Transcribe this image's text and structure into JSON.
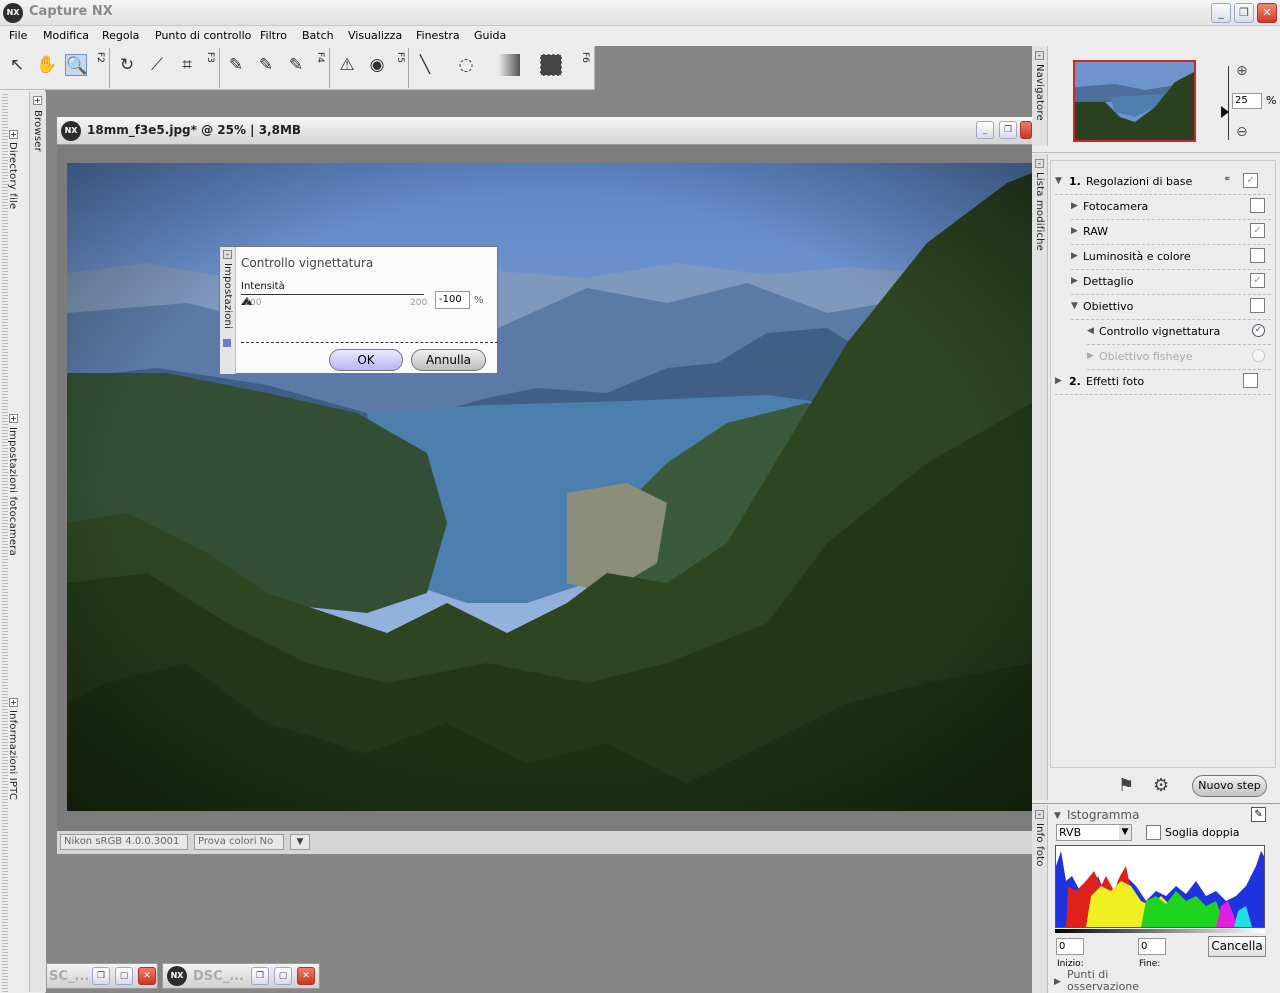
{
  "app": {
    "logo": "NX",
    "title": "Capture NX"
  },
  "window_controls": {
    "minimize": "_",
    "restore": "❐",
    "close": "✕"
  },
  "menu": [
    "File",
    "Modifica",
    "Regola",
    "Punto di controllo",
    "Filtro",
    "Batch",
    "Visualizza",
    "Finestra",
    "Guida"
  ],
  "toolbar": {
    "tools": [
      "arrow-icon",
      "hand-icon",
      "zoom-icon",
      "rotate-icon",
      "straighten-icon",
      "crop-icon",
      "black-point-icon",
      "neutral-point-icon",
      "white-point-icon",
      "red-eye-icon",
      "eye-icon",
      "brush-icon",
      "lasso-icon",
      "gradient-icon",
      "fill-icon"
    ],
    "fkeys": [
      "F2",
      "F3",
      "F4",
      "F5",
      "F6"
    ]
  },
  "left_sidebar": {
    "tabs": [
      "Browser",
      "Directory file",
      "Impostazioni fotocamera",
      "Informazioni IPTC"
    ]
  },
  "document": {
    "logo": "NX",
    "title": "18mm_f3e5.jpg* @ 25% | 3,8MB",
    "status": {
      "profile": "Nikon sRGB 4.0.0.3001",
      "proof": "Prova colori No"
    }
  },
  "dialog": {
    "side_tab": "Impostazioni",
    "title": "Controllo vignettatura",
    "field_label": "Intensità",
    "slider_min": "-200",
    "slider_max": "200",
    "value": "-100",
    "unit": "%",
    "ok_label": "OK",
    "cancel_label": "Annulla"
  },
  "navigator": {
    "tab": "Navigatore",
    "zoom_value": "25",
    "zoom_unit": "%"
  },
  "edit_list": {
    "tab": "Lista modifiche",
    "sections": [
      {
        "label": "1. Regolazioni di base",
        "number": "1.",
        "text": "Regolazioni di base"
      },
      {
        "label": "Fotocamera"
      },
      {
        "label": "RAW"
      },
      {
        "label": "Luminosità e colore"
      },
      {
        "label": "Dettaglio"
      },
      {
        "label": "Obiettivo"
      },
      {
        "label": "Controllo vignettatura"
      },
      {
        "label": "Obiettivo fisheye"
      },
      {
        "label": "2. Effetti foto",
        "number": "2.",
        "text": "Effetti foto"
      }
    ],
    "new_step": "Nuovo step"
  },
  "histogram": {
    "tab": "Info foto",
    "title": "Istogramma",
    "channel": "RVB",
    "double_threshold": "Soglia doppia",
    "start_value": "0",
    "end_value": "0",
    "start_label": "Inizio:",
    "end_label": "Fine:",
    "cancel": "Cancella",
    "next_section": "Punti di osservazione"
  },
  "taskbar": {
    "doc1": "SC_...",
    "doc2": "DSC_...",
    "doc2_logo": "NX"
  },
  "colors": {
    "accent": "#6f8fc8",
    "close": "#d9432c",
    "dialog_ok": "#c5c3f0"
  }
}
